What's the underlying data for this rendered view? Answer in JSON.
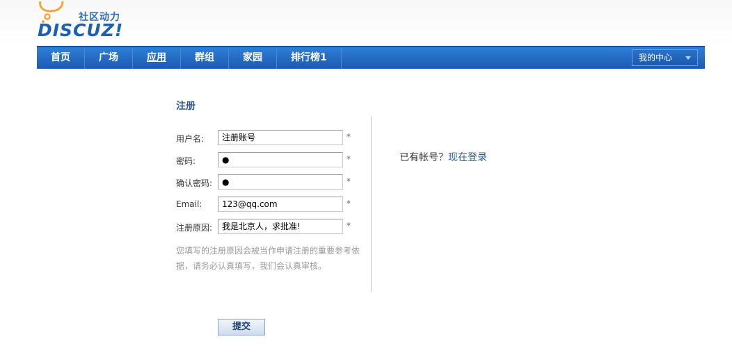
{
  "logo": {
    "brand_cn": "社区动力",
    "brand_en": "DISCUZ!"
  },
  "nav": {
    "items": [
      {
        "label": "首页"
      },
      {
        "label": "广场"
      },
      {
        "label": "应用"
      },
      {
        "label": "群组"
      },
      {
        "label": "家园"
      },
      {
        "label": "排行榜1"
      }
    ],
    "my_center": "我的中心"
  },
  "form": {
    "title": "注册",
    "fields": [
      {
        "label": "用户名:",
        "value": "注册账号",
        "required": "*"
      },
      {
        "label": "密码:",
        "value": "●",
        "required": "*"
      },
      {
        "label": "确认密码:",
        "value": "●",
        "required": "*"
      },
      {
        "label": "Email:",
        "value": "123@qq.com",
        "required": "*"
      },
      {
        "label": "注册原因:",
        "value": "我是北京人，求批准!",
        "required": "*"
      }
    ],
    "hint": "您填写的注册原因会被当作申请注册的重要参考依据，请务必认真填写，我们会认真审核。",
    "submit": "提交"
  },
  "login": {
    "prompt": "已有帐号？",
    "link": "现在登录"
  },
  "colors": {
    "nav_top": "#2f7fd6",
    "nav_bottom": "#1c5ab2",
    "link": "#2e5f94",
    "title": "#335c8a"
  }
}
